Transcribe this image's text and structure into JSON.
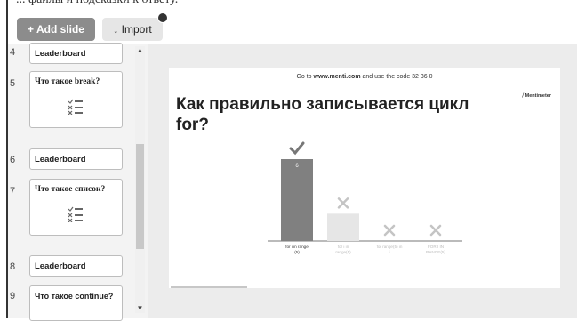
{
  "top_strip_text": "... файлы и подсказки к ответу.",
  "toolbar": {
    "add_slide_label": "+ Add slide",
    "import_label": "↓ Import"
  },
  "sidebar": {
    "items": [
      {
        "number": "4",
        "label": "Leaderboard",
        "type": "leaderboard"
      },
      {
        "number": "5",
        "label": "Что такое break?",
        "type": "question"
      },
      {
        "number": "6",
        "label": "Leaderboard",
        "type": "leaderboard"
      },
      {
        "number": "7",
        "label": "Что такое список?",
        "type": "question"
      },
      {
        "number": "8",
        "label": "Leaderboard",
        "type": "leaderboard"
      },
      {
        "number": "9",
        "label": "Что такое continue?",
        "type": "question"
      }
    ]
  },
  "slide": {
    "header_prefix": "Go to ",
    "header_link": "www.menti.com",
    "header_suffix": " and use the code 32 36 0",
    "brand": "⧸ Mentimeter",
    "title": "Как правильно записывается цикл for?"
  },
  "chart_data": {
    "type": "bar",
    "categories": [
      "for i in range (5)",
      "for i in range(5)",
      "for range(5) in i",
      "FOR I IN RANGE(5)"
    ],
    "values": [
      6,
      2,
      0,
      0
    ],
    "correct": [
      true,
      false,
      false,
      false
    ],
    "value_labels": [
      "6",
      "",
      "",
      ""
    ],
    "colors": {
      "correct": "#808080",
      "wrong": "#e6e6e6",
      "check": "#777777",
      "cross": "#c4c4c4"
    },
    "ylim": [
      0,
      6
    ]
  }
}
